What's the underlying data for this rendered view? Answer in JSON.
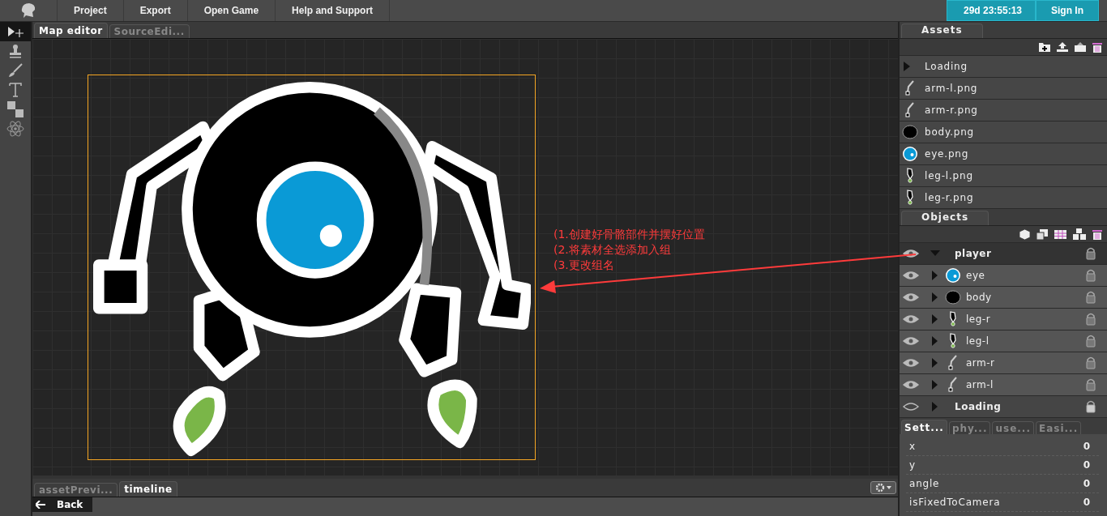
{
  "menu": {
    "items": [
      "Project",
      "Export",
      "Open Game",
      "Help and Support"
    ],
    "timer": "29d 23:55:13",
    "sign_in": "Sign In"
  },
  "tools": [
    {
      "kind": "move",
      "selected": true
    },
    {
      "kind": "stamp",
      "selected": false
    },
    {
      "kind": "brush",
      "selected": false
    },
    {
      "kind": "text",
      "selected": false
    },
    {
      "kind": "tiles",
      "selected": false
    },
    {
      "kind": "atom",
      "selected": false
    }
  ],
  "editor_tabs": [
    {
      "label": "Map editor",
      "selected": true
    },
    {
      "label": "SourceEdi...",
      "selected": false
    }
  ],
  "annotation": [
    "(1.创建好骨骼部件并摆好位置",
    "(2.将素材全选添加入组",
    "(3.更改组名"
  ],
  "bottom_tabs": [
    {
      "label": "assetPrevi...",
      "selected": false
    },
    {
      "label": "timeline",
      "selected": true
    }
  ],
  "back_button": "Back",
  "assets": {
    "tab": "Assets",
    "items": [
      {
        "label": "Loading",
        "kind": "folder"
      },
      {
        "label": "arm-l.png",
        "kind": "arm"
      },
      {
        "label": "arm-r.png",
        "kind": "arm"
      },
      {
        "label": "body.png",
        "kind": "body"
      },
      {
        "label": "eye.png",
        "kind": "eye"
      },
      {
        "label": "leg-l.png",
        "kind": "leg"
      },
      {
        "label": "leg-r.png",
        "kind": "leg"
      }
    ]
  },
  "objects": {
    "tab": "Objects",
    "items": [
      {
        "label": "player",
        "expanded": true,
        "selected": true,
        "visible": true,
        "locked": false,
        "children": [
          {
            "label": "eye",
            "kind": "eye",
            "expanded": false,
            "selected": false,
            "visible": true,
            "locked": false
          },
          {
            "label": "body",
            "kind": "body",
            "expanded": false,
            "selected": false,
            "visible": true,
            "locked": false
          },
          {
            "label": "leg-r",
            "kind": "leg",
            "expanded": false,
            "selected": false,
            "visible": true,
            "locked": false
          },
          {
            "label": "leg-l",
            "kind": "leg",
            "expanded": false,
            "selected": false,
            "visible": true,
            "locked": false
          },
          {
            "label": "arm-r",
            "kind": "arm",
            "expanded": false,
            "selected": false,
            "visible": true,
            "locked": false
          },
          {
            "label": "arm-l",
            "kind": "arm",
            "expanded": false,
            "selected": false,
            "visible": true,
            "locked": false
          }
        ]
      },
      {
        "label": "Loading",
        "expanded": false,
        "selected": false,
        "visible": false,
        "locked": true
      }
    ]
  },
  "settings": {
    "tabs": [
      {
        "label": "Sett...",
        "selected": true
      },
      {
        "label": "phy...",
        "selected": false
      },
      {
        "label": "use...",
        "selected": false
      },
      {
        "label": "Easi...",
        "selected": false
      }
    ],
    "properties": [
      {
        "name": "x",
        "value": "0"
      },
      {
        "name": "y",
        "value": "0"
      },
      {
        "name": "angle",
        "value": "0"
      },
      {
        "name": "isFixedToCamera",
        "value": "0"
      }
    ]
  }
}
